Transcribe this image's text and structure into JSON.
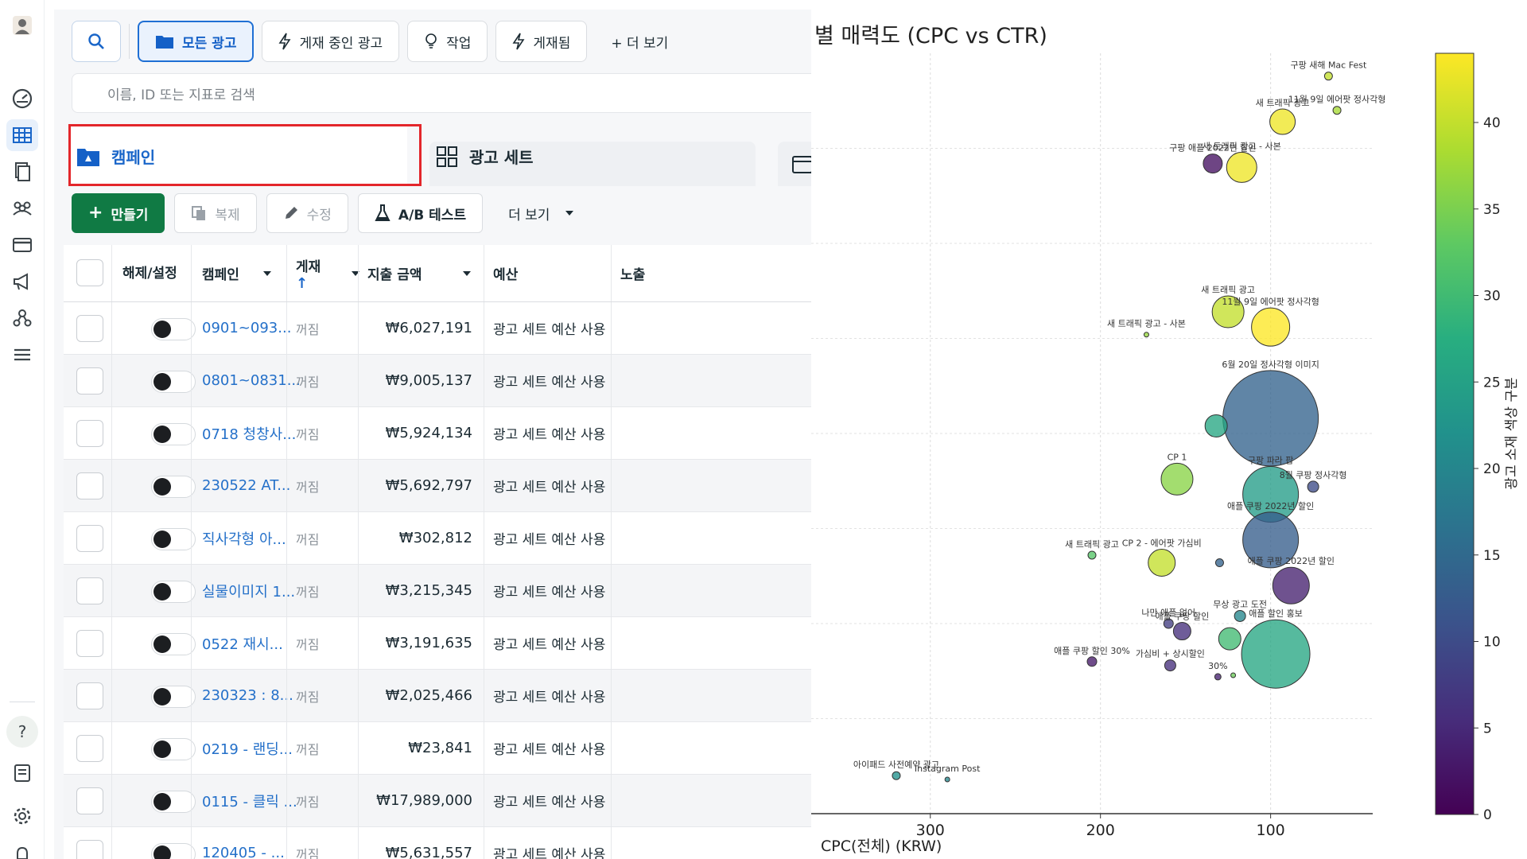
{
  "toolbar": {
    "buttons": [
      {
        "label": "모든 광고",
        "icon": "folder-icon"
      },
      {
        "label": "게재 중인 광고",
        "icon": "bolt-icon"
      },
      {
        "label": "작업",
        "icon": "lightbulb-icon"
      },
      {
        "label": "게재됨",
        "icon": "bolt-icon"
      },
      {
        "label": "+ 더 보기",
        "icon": "plus-icon"
      }
    ],
    "search_placeholder": "이름, ID 또는 지표로 검색"
  },
  "tabs": [
    {
      "label": "캠페인",
      "selected": true
    },
    {
      "label": "광고 세트",
      "selected": false
    }
  ],
  "actions": {
    "create": "만들기",
    "duplicate": "복제",
    "edit": "수정",
    "ab_test": "A/B 테스트",
    "more": "더 보기"
  },
  "table": {
    "headers": {
      "toggle": "해제/설정",
      "campaign": "캠페인",
      "delivery": "게재",
      "delivery_sort": "↑",
      "spend": "지출 금액",
      "budget": "예산",
      "impressions": "노출"
    },
    "rows": [
      {
        "campaign": "0901~093...",
        "delivery": "꺼짐",
        "spend": "₩6,027,191",
        "budget": "광고 세트 예산 사용"
      },
      {
        "campaign": "0801~0831...",
        "delivery": "꺼짐",
        "spend": "₩9,005,137",
        "budget": "광고 세트 예산 사용"
      },
      {
        "campaign": "0718 청창사...",
        "delivery": "꺼짐",
        "spend": "₩5,924,134",
        "budget": "광고 세트 예산 사용"
      },
      {
        "campaign": "230522 AT...",
        "delivery": "꺼짐",
        "spend": "₩5,692,797",
        "budget": "광고 세트 예산 사용"
      },
      {
        "campaign": "직사각형 아...",
        "delivery": "꺼짐",
        "spend": "₩302,812",
        "budget": "광고 세트 예산 사용"
      },
      {
        "campaign": "실물이미지 1...",
        "delivery": "꺼짐",
        "spend": "₩3,215,345",
        "budget": "광고 세트 예산 사용"
      },
      {
        "campaign": "0522 재시...",
        "delivery": "꺼짐",
        "spend": "₩3,191,635",
        "budget": "광고 세트 예산 사용"
      },
      {
        "campaign": "230323 : 8...",
        "delivery": "꺼짐",
        "spend": "₩2,025,466",
        "budget": "광고 세트 예산 사용"
      },
      {
        "campaign": "0219 - 랜딩...",
        "delivery": "꺼짐",
        "spend": "₩23,841",
        "budget": "광고 세트 예산 사용"
      },
      {
        "campaign": "0115 - 클릭 ...",
        "delivery": "꺼짐",
        "spend": "₩17,989,000",
        "budget": "광고 세트 예산 사용"
      },
      {
        "campaign": "120405 - ...",
        "delivery": "꺼짐",
        "spend": "₩5,631,557",
        "budget": "광고 세트 예산 사용"
      }
    ]
  },
  "chart_data": {
    "type": "scatter",
    "title": "별 매력도 (CPC vs CTR)",
    "xlabel": "CPC(전체) (KRW)",
    "x_inverted": true,
    "xlim": [
      370,
      40
    ],
    "x_ticks": [
      300,
      200,
      100
    ],
    "ylim": [
      0,
      10
    ],
    "colorbar": {
      "label": "광고 소재 색상 구분",
      "range": [
        0,
        44
      ],
      "ticks": [
        0,
        5,
        10,
        15,
        20,
        25,
        30,
        35,
        40
      ],
      "colormap": "viridis"
    },
    "grid": true,
    "points": [
      {
        "x": 66,
        "y": 9.7,
        "size": 10,
        "color": 40,
        "label": "구팡 새해 Mac Fest"
      },
      {
        "x": 61,
        "y": 9.25,
        "size": 10,
        "color": 38,
        "label": "11월 9일 에어팟 정사각형"
      },
      {
        "x": 93,
        "y": 9.1,
        "size": 32,
        "color": 43,
        "label": "새 트래픽 광고"
      },
      {
        "x": 134,
        "y": 8.55,
        "size": 24,
        "color": 2,
        "label": "구팡 애플 2022년 할인"
      },
      {
        "x": 117,
        "y": 8.5,
        "size": 38,
        "color": 43,
        "label": "새 트래픽 광고 - 사본"
      },
      {
        "x": 125,
        "y": 6.6,
        "size": 40,
        "color": 40,
        "label": "새 트래픽 광고"
      },
      {
        "x": 100,
        "y": 6.4,
        "size": 48,
        "color": 44,
        "label": "11월 9일 에어팟 정사각형"
      },
      {
        "x": 173,
        "y": 6.3,
        "size": 6,
        "color": 37,
        "label": "새 트래픽 광고 - 사본"
      },
      {
        "x": 100,
        "y": 5.2,
        "size": 120,
        "color": 14,
        "label": "6월 20일 정사각형 이미지"
      },
      {
        "x": 132,
        "y": 5.1,
        "size": 28,
        "color": 26,
        "label": ""
      },
      {
        "x": 155,
        "y": 4.4,
        "size": 40,
        "color": 36,
        "label": "CP 1"
      },
      {
        "x": 100,
        "y": 4.2,
        "size": 70,
        "color": 24,
        "label": "구팡 파라 팝"
      },
      {
        "x": 75,
        "y": 4.3,
        "size": 14,
        "color": 10,
        "label": "8월 쿠팡 정사각형"
      },
      {
        "x": 100,
        "y": 3.6,
        "size": 70,
        "color": 13,
        "label": "애플 쿠팡 2022년 할인"
      },
      {
        "x": 205,
        "y": 3.4,
        "size": 10,
        "color": 32,
        "label": "새 트래픽 광고"
      },
      {
        "x": 164,
        "y": 3.3,
        "size": 34,
        "color": 40,
        "label": "CP 2 - 에어팟 가심비"
      },
      {
        "x": 130,
        "y": 3.3,
        "size": 10,
        "color": 14,
        "label": ""
      },
      {
        "x": 88,
        "y": 3.0,
        "size": 46,
        "color": 4,
        "label": "애플 쿠팡 2022년 할인"
      },
      {
        "x": 160,
        "y": 2.5,
        "size": 12,
        "color": 8,
        "label": "나만 애플 없어"
      },
      {
        "x": 118,
        "y": 2.6,
        "size": 14,
        "color": 20,
        "label": "무상 광고 도전"
      },
      {
        "x": 152,
        "y": 2.4,
        "size": 22,
        "color": 6,
        "label": "애플 쿠팡 할인"
      },
      {
        "x": 97,
        "y": 2.1,
        "size": 86,
        "color": 26,
        "label": "애플 할인 홍보"
      },
      {
        "x": 124,
        "y": 2.3,
        "size": 28,
        "color": 30,
        "label": ""
      },
      {
        "x": 205,
        "y": 2.0,
        "size": 12,
        "color": 3,
        "label": "애플 쿠팡 할인 30%"
      },
      {
        "x": 159,
        "y": 1.95,
        "size": 14,
        "color": 6,
        "label": "가심비 + 상시할인"
      },
      {
        "x": 131,
        "y": 1.8,
        "size": 8,
        "color": 4,
        "label": "30%"
      },
      {
        "x": 122,
        "y": 1.82,
        "size": 6,
        "color": 34,
        "label": ""
      },
      {
        "x": 320,
        "y": 0.5,
        "size": 10,
        "color": 22,
        "label": "아이패드 사전예약 광고"
      },
      {
        "x": 290,
        "y": 0.45,
        "size": 4,
        "color": 20,
        "label": "Instagram Post"
      }
    ],
    "point_label_text": [
      "구팡 새해 Mac Fest",
      "11월 9일 에어팟 정사각형",
      "새 트래픽 광고",
      "구팡 애플 2022년 할인",
      "새 트래픽 광고 - 사본",
      "6월 20일 정사각형 이미지",
      "CP 1",
      "CP 2 - 에어팟 가심비",
      "나만 애플 없어",
      "가심비 + 상시할인",
      "아이패드 사전예약 광고",
      "Instagram Post"
    ]
  }
}
